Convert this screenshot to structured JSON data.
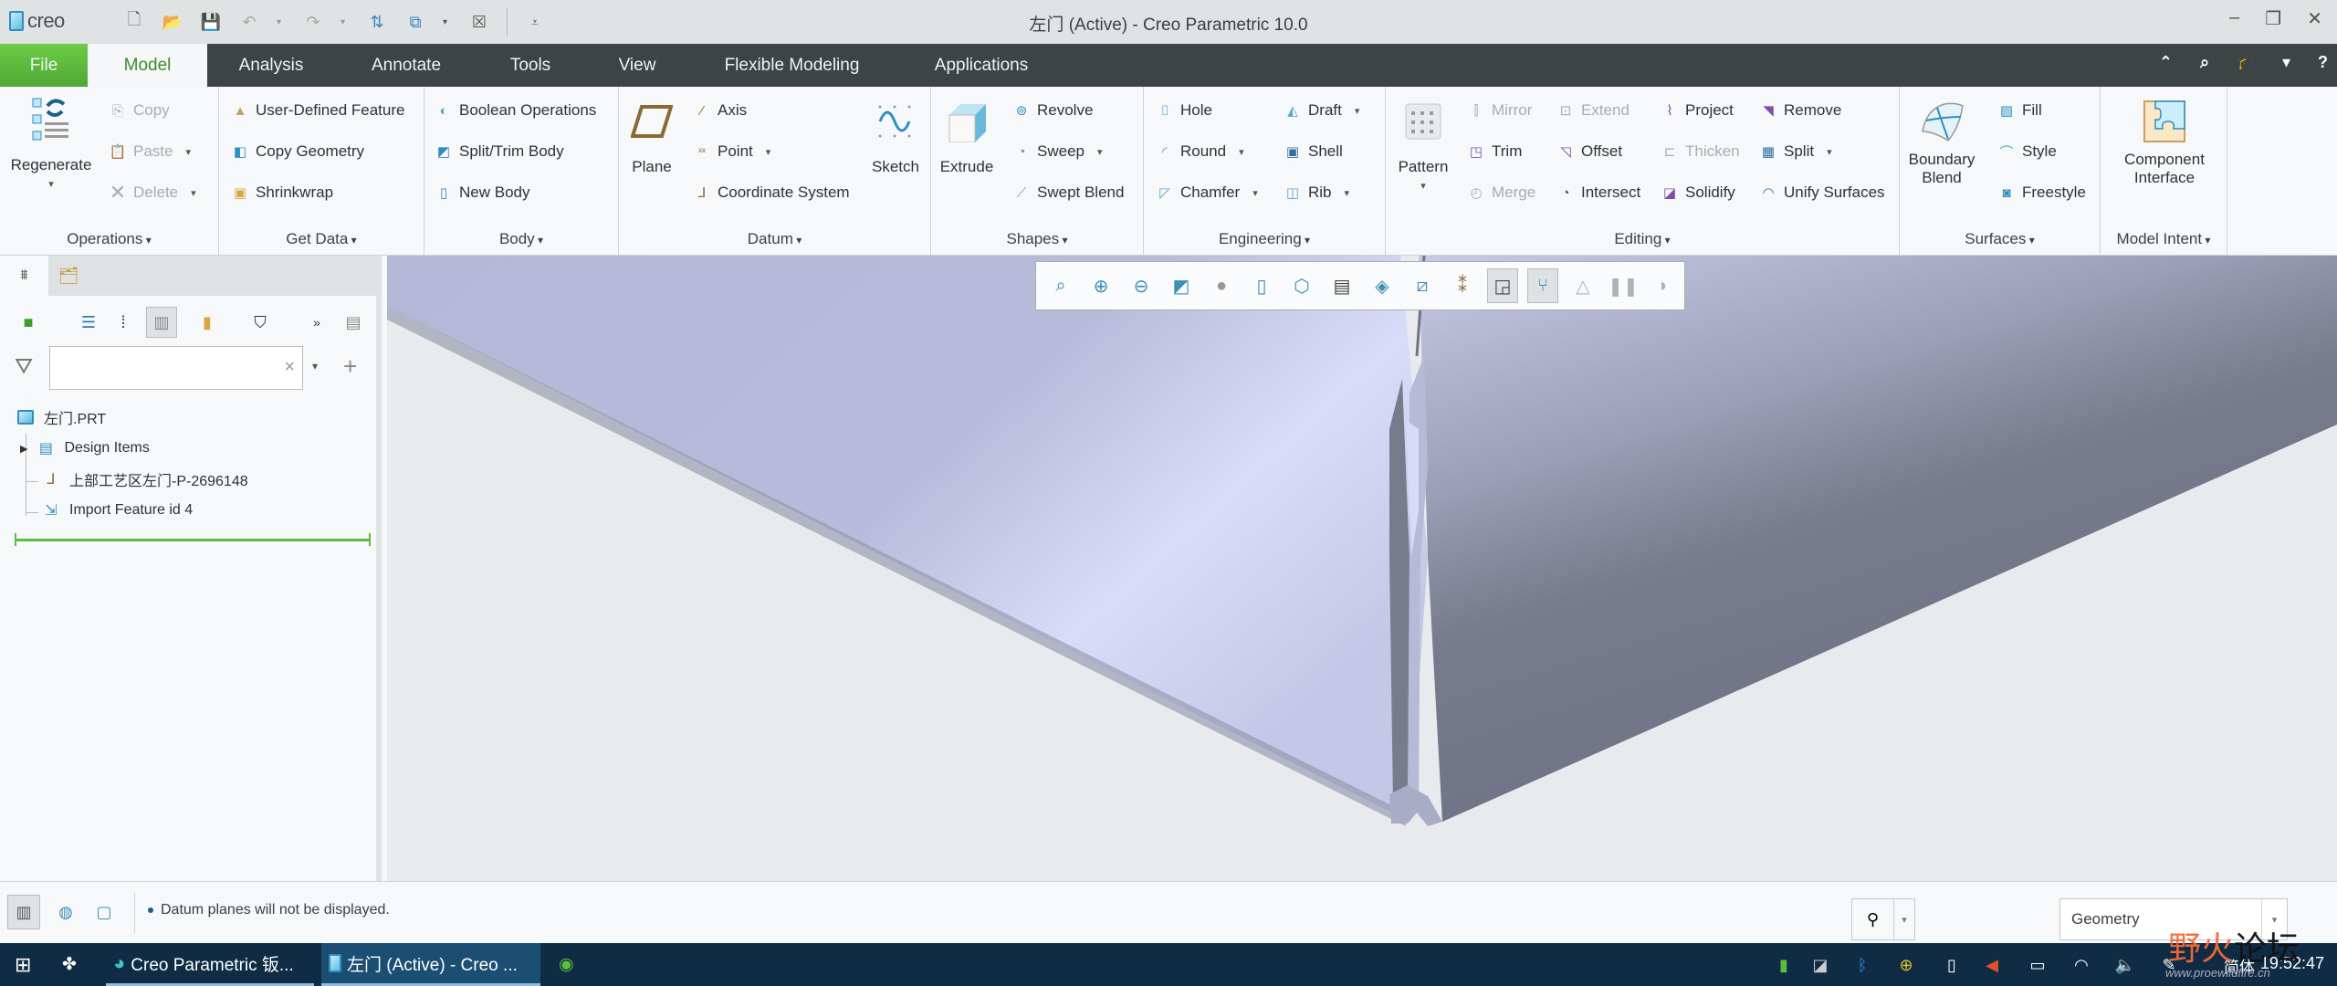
{
  "app": {
    "logo_text": "creo",
    "window_title": "左门 (Active) - Creo Parametric 10.0"
  },
  "quick_access": {
    "items": [
      "new-icon",
      "open-icon",
      "save-icon",
      "undo-icon",
      "redo-icon",
      "regenerate-icon",
      "windows-icon",
      "close-window-icon",
      "customize-icon"
    ]
  },
  "window_controls": {
    "minimize": "–",
    "restore": "❐",
    "close": "✕"
  },
  "tabs": [
    {
      "label": "File"
    },
    {
      "label": "Model",
      "active": true
    },
    {
      "label": "Analysis"
    },
    {
      "label": "Annotate"
    },
    {
      "label": "Tools"
    },
    {
      "label": "View"
    },
    {
      "label": "Flexible Modeling"
    },
    {
      "label": "Applications"
    }
  ],
  "tabbar_right": {
    "collapse": "⌃",
    "search": "⌕",
    "learn": "🎓",
    "dropdown": "▾",
    "help": "?"
  },
  "ribbon": {
    "operations": {
      "label": "Operations",
      "regenerate": "Regenerate",
      "copy": "Copy",
      "paste": "Paste",
      "delete": "Delete"
    },
    "get_data": {
      "label": "Get Data",
      "udf": "User-Defined Feature",
      "copy_geometry": "Copy Geometry",
      "shrinkwrap": "Shrinkwrap"
    },
    "body": {
      "label": "Body",
      "boolean": "Boolean Operations",
      "split_trim": "Split/Trim Body",
      "new_body": "New Body"
    },
    "datum": {
      "label": "Datum",
      "plane": "Plane",
      "axis": "Axis",
      "point": "Point",
      "csys": "Coordinate System",
      "sketch": "Sketch"
    },
    "shapes": {
      "label": "Shapes",
      "extrude": "Extrude",
      "revolve": "Revolve",
      "sweep": "Sweep",
      "swept_blend": "Swept Blend"
    },
    "engineering": {
      "label": "Engineering",
      "hole": "Hole",
      "round": "Round",
      "chamfer": "Chamfer",
      "draft": "Draft",
      "shell": "Shell",
      "rib": "Rib"
    },
    "editing": {
      "label": "Editing",
      "pattern": "Pattern",
      "mirror": "Mirror",
      "trim": "Trim",
      "merge": "Merge",
      "extend": "Extend",
      "offset": "Offset",
      "intersect": "Intersect",
      "project": "Project",
      "thicken": "Thicken",
      "solidify": "Solidify",
      "remove": "Remove",
      "split": "Split",
      "unify": "Unify Surfaces"
    },
    "surfaces": {
      "label": "Surfaces",
      "boundary_blend_1": "Boundary",
      "boundary_blend_2": "Blend",
      "fill": "Fill",
      "style": "Style",
      "freestyle": "Freestyle"
    },
    "model_intent": {
      "label": "Model Intent",
      "component_interface_1": "Component",
      "component_interface_2": "Interface"
    }
  },
  "model_tree": {
    "search_placeholder": "",
    "search_value": "",
    "items": [
      {
        "label": "左门.PRT",
        "icon": "part-icon"
      },
      {
        "label": "Design Items",
        "icon": "design-items-icon",
        "expandable": true
      },
      {
        "label": "上部工艺区左门-P-2696148",
        "icon": "csys-icon"
      },
      {
        "label": "Import Feature id 4",
        "icon": "import-feature-icon"
      }
    ]
  },
  "graphics_toolbar": {
    "items": [
      "refit-icon",
      "zoom-in-icon",
      "zoom-out-icon",
      "repaint-icon",
      "display-style-icon",
      "saved-orientations-icon",
      "named-views-icon",
      "view-manager-icon",
      "perspective-icon",
      "datum-display-icon",
      "annotation-display-icon",
      "spin-center-icon",
      "selection-display-icon",
      "simulation-icon",
      "pause-icon",
      "section-icon"
    ]
  },
  "status": {
    "message": "Datum planes will not be displayed.",
    "filter_value": "Geometry"
  },
  "taskbar": {
    "items": [
      {
        "label": "Creo Parametric 钣...",
        "icon": "edge-icon"
      },
      {
        "label": "左门 (Active) - Creo ...",
        "icon": "creo-icon",
        "active": true
      }
    ],
    "ime": "简体",
    "clock": "19:52:47"
  },
  "watermark": {
    "text_a": "野火",
    "text_b": "论坛",
    "url": "www.proewildfire.cn"
  },
  "colors": {
    "accent_green": "#5bbf3c",
    "tab_bar": "#3c4446",
    "model_light": "#b7bbd8",
    "model_dark": "#777b8c",
    "viewport_bg": "#e9eaee"
  }
}
